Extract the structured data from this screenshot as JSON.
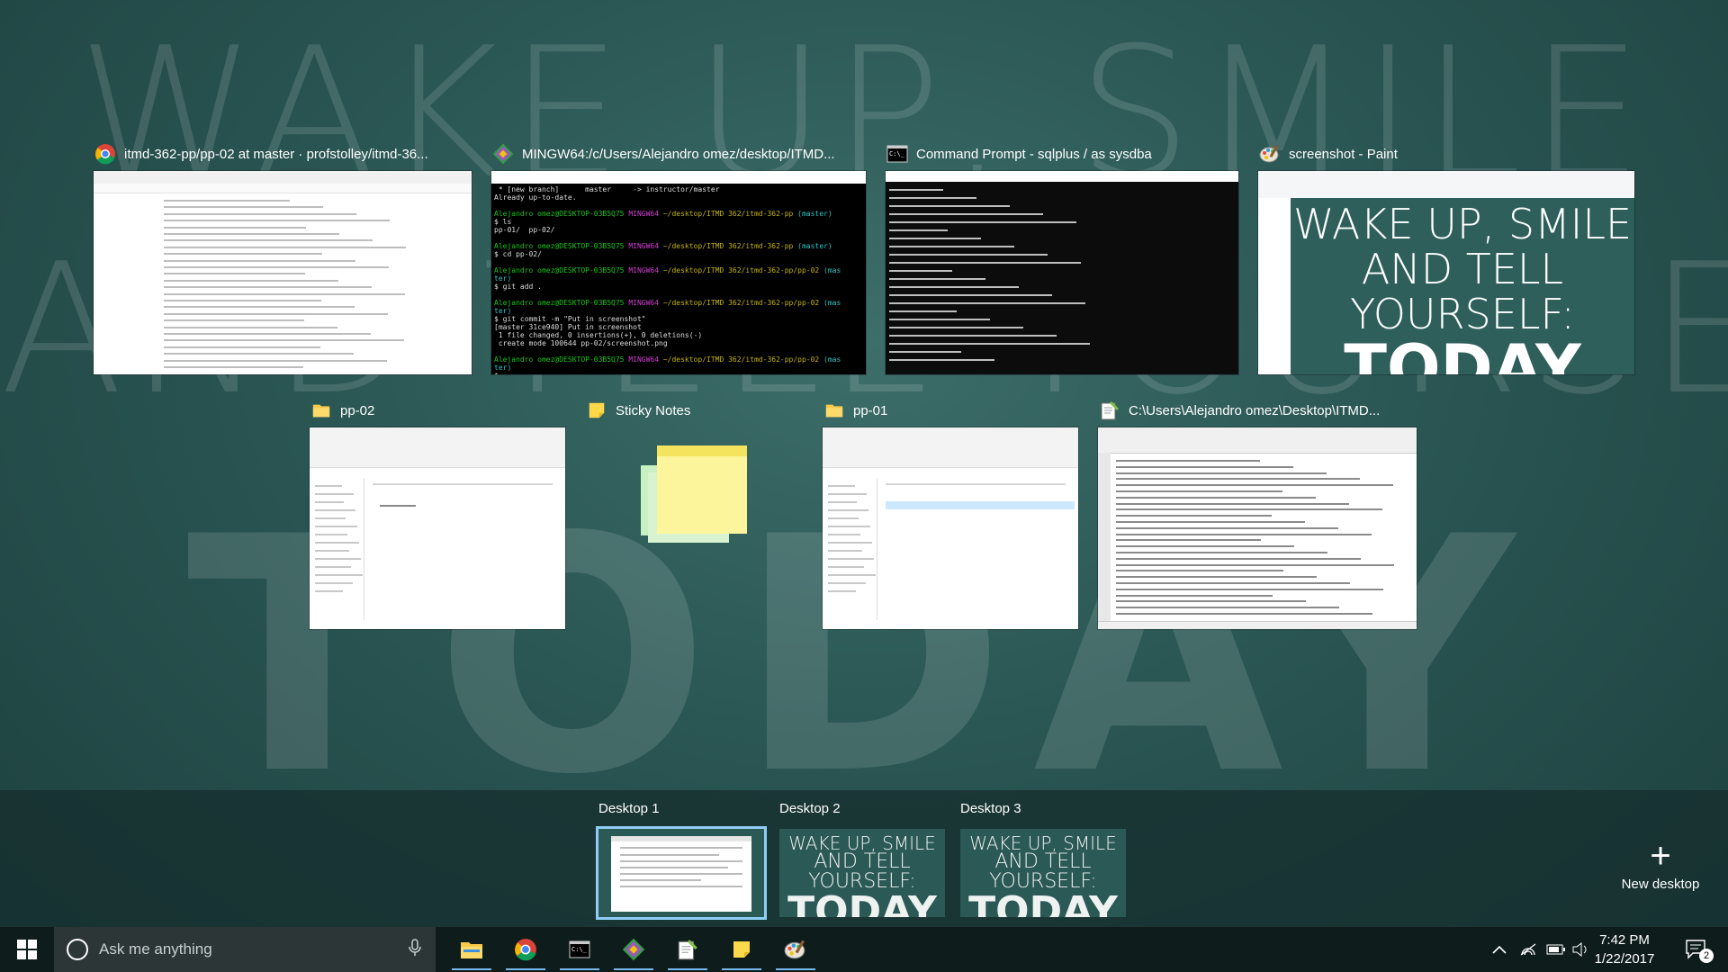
{
  "background": {
    "line1": "WAKE UP, SMILE",
    "line2": "AND TELL YOURSELF:",
    "line3": "TODAY"
  },
  "windows": [
    {
      "title": "itmd-362-pp/pp-02 at master · profstolley/itmd-36...",
      "icon": "chrome-icon"
    },
    {
      "title": "MINGW64:/c/Users/Alejandro omez/desktop/ITMD...",
      "icon": "git-icon"
    },
    {
      "title": "Command Prompt - sqlplus  / as sysdba",
      "icon": "cmd-icon"
    },
    {
      "title": "screenshot - Paint",
      "icon": "paint-icon"
    },
    {
      "title": "pp-02",
      "icon": "folder-icon"
    },
    {
      "title": "Sticky Notes",
      "icon": "sticky-notes-icon"
    },
    {
      "title": "pp-01",
      "icon": "folder-icon"
    },
    {
      "title": "C:\\Users\\Alejandro omez\\Desktop\\ITMD...",
      "icon": "notepad-plus-icon"
    }
  ],
  "terminal_lines": [
    " * [new branch]      master     -> instructor/master",
    "Already up-to-date.",
    "",
    "Alejandro omez@DESKTOP-03B5Q75 MINGW64 ~/desktop/ITMD 362/itmd-362-pp (master)",
    "$ ls",
    "pp-01/  pp-02/",
    "",
    "Alejandro omez@DESKTOP-03B5Q75 MINGW64 ~/desktop/ITMD 362/itmd-362-pp (master)",
    "$ cd pp-02/",
    "",
    "Alejandro omez@DESKTOP-03B5Q75 MINGW64 ~/desktop/ITMD 362/itmd-362-pp/pp-02 (mas",
    "ter)",
    "$ git add .",
    "",
    "Alejandro omez@DESKTOP-03B5Q75 MINGW64 ~/desktop/ITMD 362/itmd-362-pp/pp-02 (mas",
    "ter)",
    "$ git commit -m \"Put in screenshot\"",
    "[master 31ce940] Put in screenshot",
    " 1 file changed, 0 insertions(+), 0 deletions(-)",
    " create mode 100644 pp-02/screenshot.png",
    "",
    "Alejandro omez@DESKTOP-03B5Q75 MINGW64 ~/desktop/ITMD 362/itmd-362-pp/pp-02 (mas",
    "ter)",
    "$"
  ],
  "desktops": [
    {
      "label": "Desktop 1",
      "active": true
    },
    {
      "label": "Desktop 2",
      "active": false
    },
    {
      "label": "Desktop 3",
      "active": false
    }
  ],
  "new_desktop_label": "New desktop",
  "taskbar": {
    "search_placeholder": "Ask me anything",
    "pinned": [
      "file-explorer-icon",
      "chrome-icon",
      "cmd-icon",
      "git-icon",
      "notepad-plus-icon",
      "sticky-notes-icon",
      "paint-icon"
    ],
    "time": "7:42 PM",
    "date": "1/22/2017",
    "notification_count": "2"
  },
  "colors": {
    "accent": "#76b9ed",
    "active_desktop_outline": "#8ecdf5",
    "taskbar": "#0f1c1c"
  }
}
